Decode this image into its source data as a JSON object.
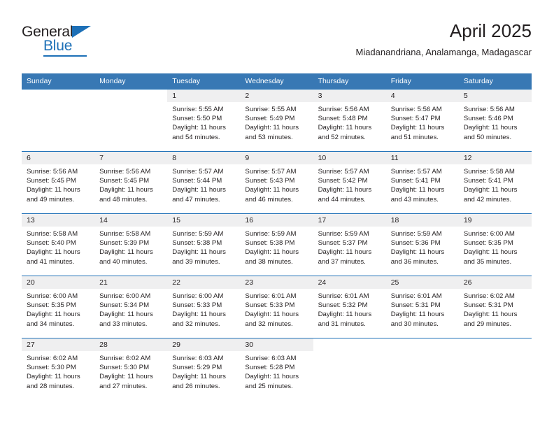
{
  "brand": {
    "name_line1": "General",
    "name_line2": "Blue",
    "accent_color": "#1d70b7"
  },
  "header": {
    "title": "April 2025",
    "subtitle": "Miadanandriana, Analamanga, Madagascar"
  },
  "calendar": {
    "header_bg": "#3878b4",
    "row_border_color": "#1d70b7",
    "date_strip_bg": "#efeff0",
    "weekdays": [
      "Sunday",
      "Monday",
      "Tuesday",
      "Wednesday",
      "Thursday",
      "Friday",
      "Saturday"
    ],
    "weeks": [
      [
        {
          "day": "",
          "sunrise": "",
          "sunset": "",
          "daylight_line1": "",
          "daylight_line2": ""
        },
        {
          "day": "",
          "sunrise": "",
          "sunset": "",
          "daylight_line1": "",
          "daylight_line2": ""
        },
        {
          "day": "1",
          "sunrise": "Sunrise: 5:55 AM",
          "sunset": "Sunset: 5:50 PM",
          "daylight_line1": "Daylight: 11 hours",
          "daylight_line2": "and 54 minutes."
        },
        {
          "day": "2",
          "sunrise": "Sunrise: 5:55 AM",
          "sunset": "Sunset: 5:49 PM",
          "daylight_line1": "Daylight: 11 hours",
          "daylight_line2": "and 53 minutes."
        },
        {
          "day": "3",
          "sunrise": "Sunrise: 5:56 AM",
          "sunset": "Sunset: 5:48 PM",
          "daylight_line1": "Daylight: 11 hours",
          "daylight_line2": "and 52 minutes."
        },
        {
          "day": "4",
          "sunrise": "Sunrise: 5:56 AM",
          "sunset": "Sunset: 5:47 PM",
          "daylight_line1": "Daylight: 11 hours",
          "daylight_line2": "and 51 minutes."
        },
        {
          "day": "5",
          "sunrise": "Sunrise: 5:56 AM",
          "sunset": "Sunset: 5:46 PM",
          "daylight_line1": "Daylight: 11 hours",
          "daylight_line2": "and 50 minutes."
        }
      ],
      [
        {
          "day": "6",
          "sunrise": "Sunrise: 5:56 AM",
          "sunset": "Sunset: 5:45 PM",
          "daylight_line1": "Daylight: 11 hours",
          "daylight_line2": "and 49 minutes."
        },
        {
          "day": "7",
          "sunrise": "Sunrise: 5:56 AM",
          "sunset": "Sunset: 5:45 PM",
          "daylight_line1": "Daylight: 11 hours",
          "daylight_line2": "and 48 minutes."
        },
        {
          "day": "8",
          "sunrise": "Sunrise: 5:57 AM",
          "sunset": "Sunset: 5:44 PM",
          "daylight_line1": "Daylight: 11 hours",
          "daylight_line2": "and 47 minutes."
        },
        {
          "day": "9",
          "sunrise": "Sunrise: 5:57 AM",
          "sunset": "Sunset: 5:43 PM",
          "daylight_line1": "Daylight: 11 hours",
          "daylight_line2": "and 46 minutes."
        },
        {
          "day": "10",
          "sunrise": "Sunrise: 5:57 AM",
          "sunset": "Sunset: 5:42 PM",
          "daylight_line1": "Daylight: 11 hours",
          "daylight_line2": "and 44 minutes."
        },
        {
          "day": "11",
          "sunrise": "Sunrise: 5:57 AM",
          "sunset": "Sunset: 5:41 PM",
          "daylight_line1": "Daylight: 11 hours",
          "daylight_line2": "and 43 minutes."
        },
        {
          "day": "12",
          "sunrise": "Sunrise: 5:58 AM",
          "sunset": "Sunset: 5:41 PM",
          "daylight_line1": "Daylight: 11 hours",
          "daylight_line2": "and 42 minutes."
        }
      ],
      [
        {
          "day": "13",
          "sunrise": "Sunrise: 5:58 AM",
          "sunset": "Sunset: 5:40 PM",
          "daylight_line1": "Daylight: 11 hours",
          "daylight_line2": "and 41 minutes."
        },
        {
          "day": "14",
          "sunrise": "Sunrise: 5:58 AM",
          "sunset": "Sunset: 5:39 PM",
          "daylight_line1": "Daylight: 11 hours",
          "daylight_line2": "and 40 minutes."
        },
        {
          "day": "15",
          "sunrise": "Sunrise: 5:59 AM",
          "sunset": "Sunset: 5:38 PM",
          "daylight_line1": "Daylight: 11 hours",
          "daylight_line2": "and 39 minutes."
        },
        {
          "day": "16",
          "sunrise": "Sunrise: 5:59 AM",
          "sunset": "Sunset: 5:38 PM",
          "daylight_line1": "Daylight: 11 hours",
          "daylight_line2": "and 38 minutes."
        },
        {
          "day": "17",
          "sunrise": "Sunrise: 5:59 AM",
          "sunset": "Sunset: 5:37 PM",
          "daylight_line1": "Daylight: 11 hours",
          "daylight_line2": "and 37 minutes."
        },
        {
          "day": "18",
          "sunrise": "Sunrise: 5:59 AM",
          "sunset": "Sunset: 5:36 PM",
          "daylight_line1": "Daylight: 11 hours",
          "daylight_line2": "and 36 minutes."
        },
        {
          "day": "19",
          "sunrise": "Sunrise: 6:00 AM",
          "sunset": "Sunset: 5:35 PM",
          "daylight_line1": "Daylight: 11 hours",
          "daylight_line2": "and 35 minutes."
        }
      ],
      [
        {
          "day": "20",
          "sunrise": "Sunrise: 6:00 AM",
          "sunset": "Sunset: 5:35 PM",
          "daylight_line1": "Daylight: 11 hours",
          "daylight_line2": "and 34 minutes."
        },
        {
          "day": "21",
          "sunrise": "Sunrise: 6:00 AM",
          "sunset": "Sunset: 5:34 PM",
          "daylight_line1": "Daylight: 11 hours",
          "daylight_line2": "and 33 minutes."
        },
        {
          "day": "22",
          "sunrise": "Sunrise: 6:00 AM",
          "sunset": "Sunset: 5:33 PM",
          "daylight_line1": "Daylight: 11 hours",
          "daylight_line2": "and 32 minutes."
        },
        {
          "day": "23",
          "sunrise": "Sunrise: 6:01 AM",
          "sunset": "Sunset: 5:33 PM",
          "daylight_line1": "Daylight: 11 hours",
          "daylight_line2": "and 32 minutes."
        },
        {
          "day": "24",
          "sunrise": "Sunrise: 6:01 AM",
          "sunset": "Sunset: 5:32 PM",
          "daylight_line1": "Daylight: 11 hours",
          "daylight_line2": "and 31 minutes."
        },
        {
          "day": "25",
          "sunrise": "Sunrise: 6:01 AM",
          "sunset": "Sunset: 5:31 PM",
          "daylight_line1": "Daylight: 11 hours",
          "daylight_line2": "and 30 minutes."
        },
        {
          "day": "26",
          "sunrise": "Sunrise: 6:02 AM",
          "sunset": "Sunset: 5:31 PM",
          "daylight_line1": "Daylight: 11 hours",
          "daylight_line2": "and 29 minutes."
        }
      ],
      [
        {
          "day": "27",
          "sunrise": "Sunrise: 6:02 AM",
          "sunset": "Sunset: 5:30 PM",
          "daylight_line1": "Daylight: 11 hours",
          "daylight_line2": "and 28 minutes."
        },
        {
          "day": "28",
          "sunrise": "Sunrise: 6:02 AM",
          "sunset": "Sunset: 5:30 PM",
          "daylight_line1": "Daylight: 11 hours",
          "daylight_line2": "and 27 minutes."
        },
        {
          "day": "29",
          "sunrise": "Sunrise: 6:03 AM",
          "sunset": "Sunset: 5:29 PM",
          "daylight_line1": "Daylight: 11 hours",
          "daylight_line2": "and 26 minutes."
        },
        {
          "day": "30",
          "sunrise": "Sunrise: 6:03 AM",
          "sunset": "Sunset: 5:28 PM",
          "daylight_line1": "Daylight: 11 hours",
          "daylight_line2": "and 25 minutes."
        },
        {
          "day": "",
          "sunrise": "",
          "sunset": "",
          "daylight_line1": "",
          "daylight_line2": ""
        },
        {
          "day": "",
          "sunrise": "",
          "sunset": "",
          "daylight_line1": "",
          "daylight_line2": ""
        },
        {
          "day": "",
          "sunrise": "",
          "sunset": "",
          "daylight_line1": "",
          "daylight_line2": ""
        }
      ]
    ]
  }
}
